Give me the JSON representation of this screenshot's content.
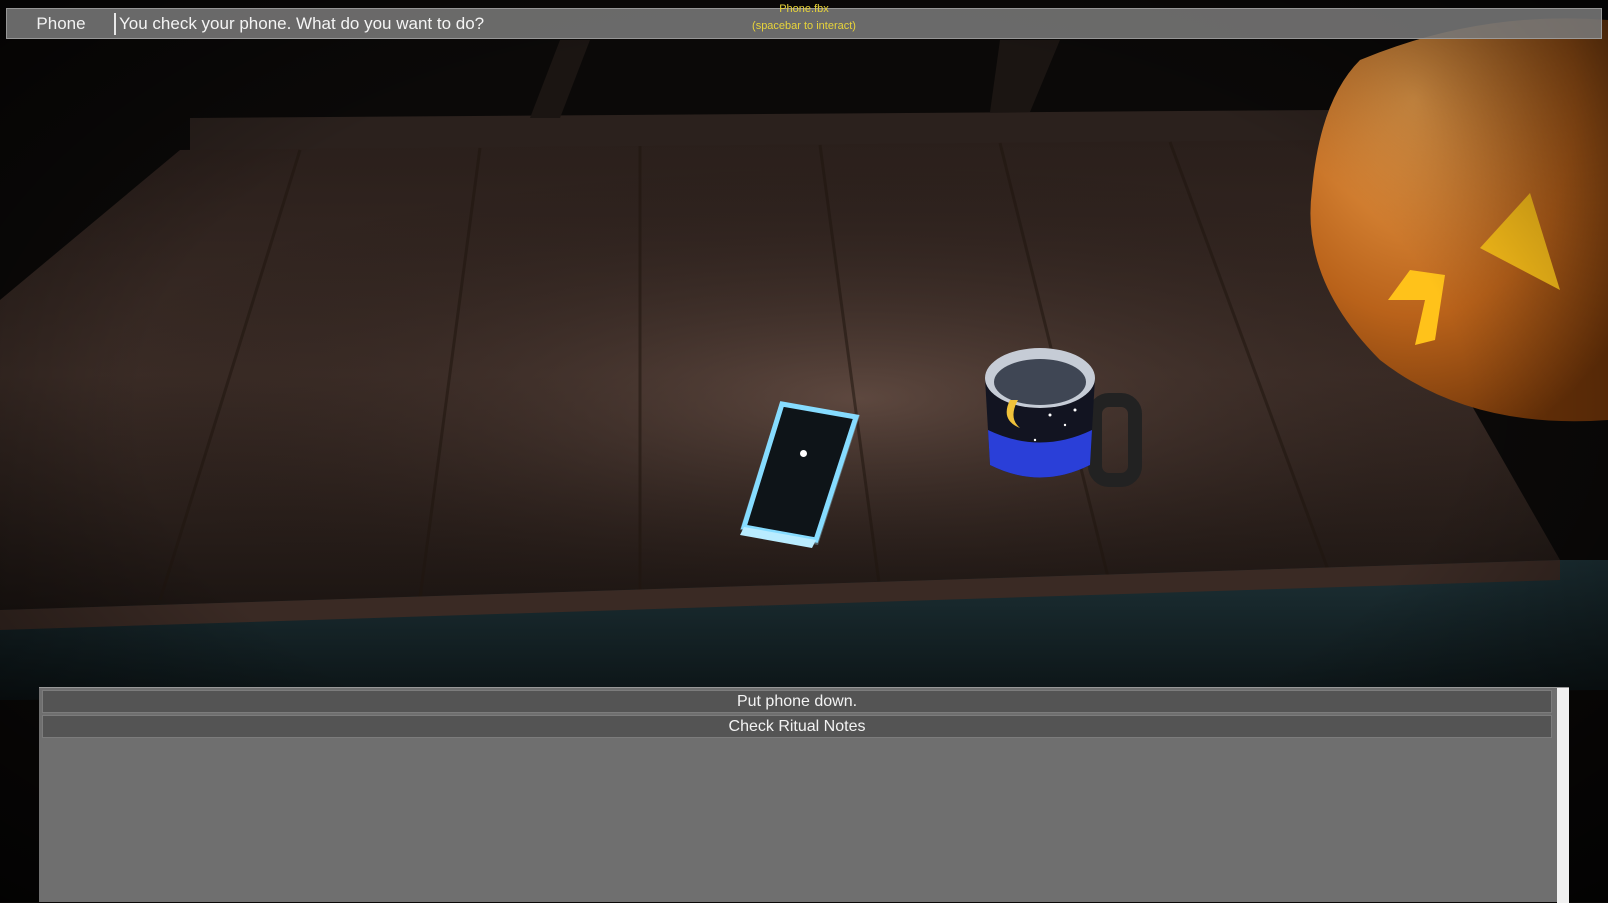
{
  "dialogue": {
    "speaker": "Phone",
    "text": "You check your phone. What do you want to do?"
  },
  "interaction_hint": {
    "object": "Phone.fbx",
    "instruction": "(spacebar to interact)"
  },
  "choices": [
    {
      "label": "Put phone down."
    },
    {
      "label": "Check Ritual Notes"
    }
  ],
  "colors": {
    "hint_text": "#e8d43a",
    "phone_glow": "#7fd8ff",
    "pumpkin": "#d9731c",
    "pumpkin_glow": "#ffc21a",
    "mug_band": "#2a3fd8"
  }
}
